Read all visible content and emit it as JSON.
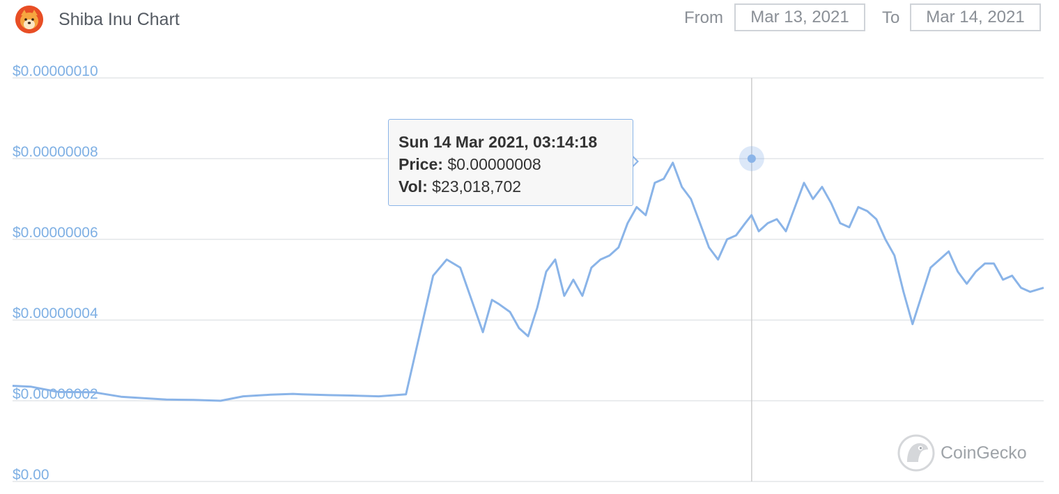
{
  "header": {
    "title": "Shiba Inu Chart",
    "from_label": "From",
    "from_value": "Mar 13, 2021",
    "to_label": "To",
    "to_value": "Mar 14, 2021"
  },
  "icons": {
    "logo": "shiba-inu-logo-icon",
    "watermark": "coingecko-gecko-icon"
  },
  "watermark": {
    "text": "CoinGecko"
  },
  "colors": {
    "line": "#8ab4e8",
    "axis_text": "#7fb0e4",
    "grid": "#e3e5e8",
    "crosshair": "#cccccc"
  },
  "tooltip": {
    "datetime": "Sun 14 Mar 2021, 03:14:18",
    "price_label": "Price:",
    "price_value": "$0.00000008",
    "vol_label": "Vol:",
    "vol_value": "$23,018,702"
  },
  "chart_data": {
    "type": "line",
    "title": "Shiba Inu Chart",
    "xlabel": "",
    "ylabel": "",
    "ylim": [
      0,
      1e-07
    ],
    "y_ticks": [
      0,
      2e-08,
      4e-08,
      6e-08,
      8e-08,
      1e-07
    ],
    "y_tick_labels": [
      "$0.00",
      "$0.00000002",
      "$0.00000004",
      "$0.00000006",
      "$0.00000008",
      "$0.00000010"
    ],
    "grid": true,
    "x_range": [
      "2021-03-13T00:00",
      "2021-03-14T14:00"
    ],
    "series": [
      {
        "x": [
          "2021-03-13T00:00",
          "2021-03-13T00:40",
          "2021-03-13T01:40",
          "2021-03-13T03:00",
          "2021-03-13T04:00",
          "2021-03-13T04:40",
          "2021-03-13T05:40",
          "2021-03-13T06:40",
          "2021-03-13T07:40",
          "2021-03-13T08:30",
          "2021-03-13T09:30",
          "2021-03-13T10:20",
          "2021-03-13T10:40",
          "2021-03-13T11:40",
          "2021-03-13T12:30",
          "2021-03-13T13:30",
          "2021-03-13T14:30",
          "2021-03-13T15:30",
          "2021-03-13T16:00",
          "2021-03-13T16:30",
          "2021-03-13T17:20",
          "2021-03-13T17:40",
          "2021-03-13T17:55",
          "2021-03-13T18:20",
          "2021-03-13T18:40",
          "2021-03-13T19:00",
          "2021-03-13T19:20",
          "2021-03-13T19:40",
          "2021-03-13T20:00",
          "2021-03-13T20:20",
          "2021-03-13T20:40",
          "2021-03-13T21:00",
          "2021-03-13T21:20",
          "2021-03-13T21:40",
          "2021-03-13T22:00",
          "2021-03-13T22:20",
          "2021-03-13T22:40",
          "2021-03-13T23:00",
          "2021-03-13T23:20",
          "2021-03-13T23:40",
          "2021-03-14T00:00",
          "2021-03-14T00:20",
          "2021-03-14T00:40",
          "2021-03-14T01:00",
          "2021-03-14T01:20",
          "2021-03-14T01:40",
          "2021-03-14T02:00",
          "2021-03-14T02:20",
          "2021-03-14T02:40",
          "2021-03-14T03:00",
          "2021-03-14T03:14",
          "2021-03-14T03:30",
          "2021-03-14T03:50",
          "2021-03-14T04:10",
          "2021-03-14T04:30",
          "2021-03-14T04:50",
          "2021-03-14T05:10",
          "2021-03-14T05:30",
          "2021-03-14T05:50",
          "2021-03-14T06:10",
          "2021-03-14T06:30",
          "2021-03-14T06:50",
          "2021-03-14T07:10",
          "2021-03-14T07:30",
          "2021-03-14T07:50",
          "2021-03-14T08:10",
          "2021-03-14T08:30",
          "2021-03-14T08:50",
          "2021-03-14T09:10",
          "2021-03-14T09:30",
          "2021-03-14T09:50",
          "2021-03-14T10:10",
          "2021-03-14T10:30",
          "2021-03-14T10:50",
          "2021-03-14T11:10",
          "2021-03-14T11:30",
          "2021-03-14T11:50",
          "2021-03-14T12:10",
          "2021-03-14T12:30",
          "2021-03-14T12:50",
          "2021-03-14T13:10",
          "2021-03-14T13:30",
          "2021-03-14T14:00"
        ],
        "values": [
          2.37e-08,
          2.35e-08,
          2.22e-08,
          2.21e-08,
          2.1e-08,
          2.07e-08,
          2.03e-08,
          2.02e-08,
          2e-08,
          2.11e-08,
          2.15e-08,
          2.17e-08,
          2.16e-08,
          2.14e-08,
          2.13e-08,
          2.11e-08,
          2.16e-08,
          5.1e-08,
          5.5e-08,
          5.3e-08,
          3.7e-08,
          4.5e-08,
          4.4e-08,
          4.2e-08,
          3.8e-08,
          3.6e-08,
          4.3e-08,
          5.2e-08,
          5.5e-08,
          4.6e-08,
          5e-08,
          4.6e-08,
          5.3e-08,
          5.5e-08,
          5.6e-08,
          5.8e-08,
          6.4e-08,
          6.8e-08,
          6.6e-08,
          7.4e-08,
          7.5e-08,
          7.9e-08,
          7.3e-08,
          7e-08,
          6.4e-08,
          5.8e-08,
          5.5e-08,
          6e-08,
          6.1e-08,
          6.4e-08,
          6.6e-08,
          6.2e-08,
          6.4e-08,
          6.5e-08,
          6.2e-08,
          6.8e-08,
          7.4e-08,
          7e-08,
          7.3e-08,
          6.9e-08,
          6.4e-08,
          6.3e-08,
          6.8e-08,
          6.7e-08,
          6.5e-08,
          6e-08,
          5.6e-08,
          4.7e-08,
          3.9e-08,
          4.6e-08,
          5.3e-08,
          5.5e-08,
          5.7e-08,
          5.2e-08,
          4.9e-08,
          5.2e-08,
          5.4e-08,
          5.4e-08,
          5e-08,
          5.1e-08,
          4.8e-08,
          4.7e-08,
          4.8e-08
        ]
      }
    ],
    "hover_point": {
      "x": "2021-03-14T03:14:18",
      "y": 8e-08,
      "volume": 23018702
    }
  }
}
